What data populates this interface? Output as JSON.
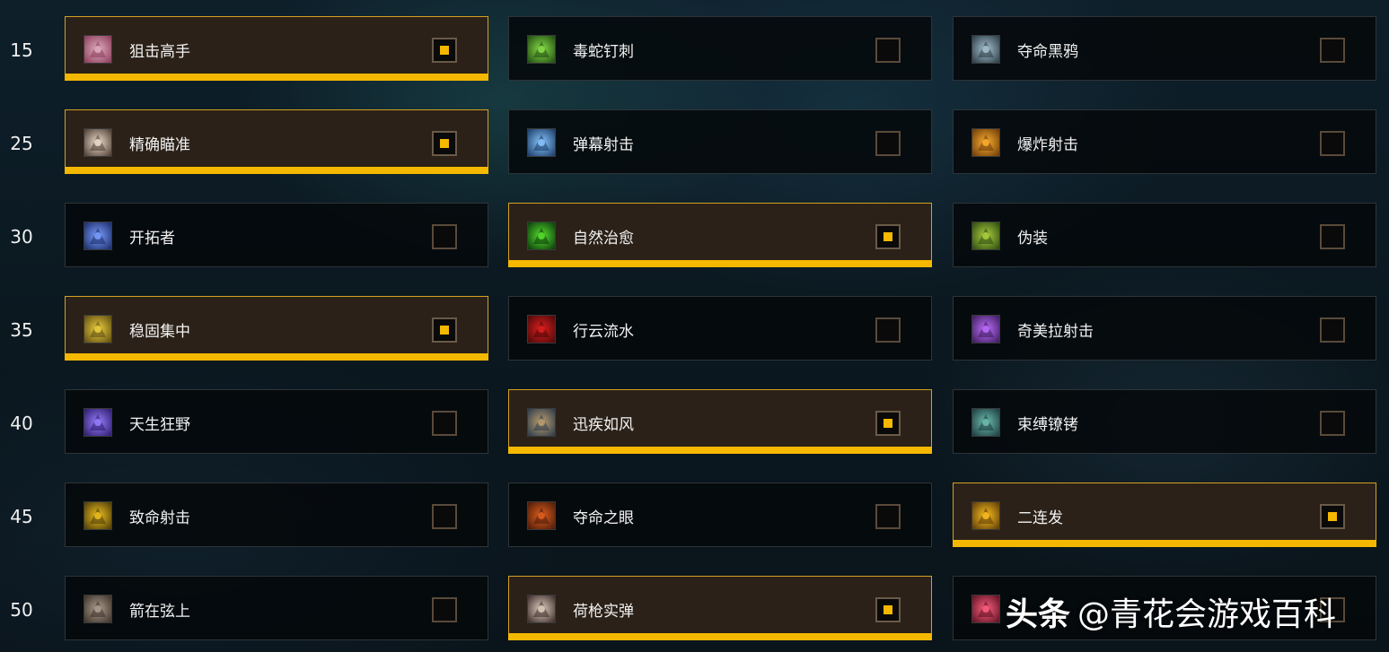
{
  "accent_color": "#f5b800",
  "rows": [
    {
      "level": "15",
      "talents": [
        {
          "name": "狙击高手",
          "selected": true,
          "icon": "eye-icon",
          "c1": "#8a3a5a",
          "c2": "#e0b0c0"
        },
        {
          "name": "毒蛇钉刺",
          "selected": false,
          "icon": "serpent-sting-icon",
          "c1": "#1e4a10",
          "c2": "#8be04a"
        },
        {
          "name": "夺命黑鸦",
          "selected": false,
          "icon": "raven-icon",
          "c1": "#2a3a44",
          "c2": "#a8c4d0"
        }
      ]
    },
    {
      "level": "25",
      "talents": [
        {
          "name": "精确瞄准",
          "selected": true,
          "icon": "aim-icon",
          "c1": "#4a3a30",
          "c2": "#f0e0d0"
        },
        {
          "name": "弹幕射击",
          "selected": false,
          "icon": "barrage-icon",
          "c1": "#1a3a66",
          "c2": "#8ac8ff"
        },
        {
          "name": "爆炸射击",
          "selected": false,
          "icon": "explosive-shot-icon",
          "c1": "#6a3a08",
          "c2": "#ffb030"
        }
      ]
    },
    {
      "level": "30",
      "talents": [
        {
          "name": "开拓者",
          "selected": false,
          "icon": "trailblazer-icon",
          "c1": "#1a2a66",
          "c2": "#7aa0ff"
        },
        {
          "name": "自然治愈",
          "selected": true,
          "icon": "natural-mending-icon",
          "c1": "#0a3a0a",
          "c2": "#58e030"
        },
        {
          "name": "伪装",
          "selected": false,
          "icon": "camouflage-icon",
          "c1": "#2a4a10",
          "c2": "#b0d040"
        }
      ]
    },
    {
      "level": "35",
      "talents": [
        {
          "name": "稳固集中",
          "selected": true,
          "icon": "steady-focus-icon",
          "c1": "#5a4a10",
          "c2": "#f0d040"
        },
        {
          "name": "行云流水",
          "selected": false,
          "icon": "streamline-icon",
          "c1": "#4a0808",
          "c2": "#e02020"
        },
        {
          "name": "奇美拉射击",
          "selected": false,
          "icon": "chimaera-shot-icon",
          "c1": "#3a1a5a",
          "c2": "#c070ff"
        }
      ]
    },
    {
      "level": "40",
      "talents": [
        {
          "name": "天生狂野",
          "selected": false,
          "icon": "born-to-be-wild-icon",
          "c1": "#2a1a6a",
          "c2": "#9a80ff"
        },
        {
          "name": "迅疾如风",
          "selected": true,
          "icon": "posthaste-icon",
          "c1": "#2a3a4a",
          "c2": "#c0a070"
        },
        {
          "name": "束缚镣铐",
          "selected": false,
          "icon": "binding-shackles-icon",
          "c1": "#1a3a40",
          "c2": "#70c0b0"
        }
      ]
    },
    {
      "level": "45",
      "talents": [
        {
          "name": "致命射击",
          "selected": false,
          "icon": "lethal-shots-icon",
          "c1": "#4a3a08",
          "c2": "#f0c020"
        },
        {
          "name": "夺命之眼",
          "selected": false,
          "icon": "dead-eye-icon",
          "c1": "#4a1a08",
          "c2": "#e06020"
        },
        {
          "name": "二连发",
          "selected": true,
          "icon": "double-tap-icon",
          "c1": "#5a3a08",
          "c2": "#ffc020"
        }
      ]
    },
    {
      "level": "50",
      "talents": [
        {
          "name": "箭在弦上",
          "selected": false,
          "icon": "calling-the-shots-icon",
          "c1": "#3a3028",
          "c2": "#b0a090"
        },
        {
          "name": "荷枪实弹",
          "selected": true,
          "icon": "lock-and-load-icon",
          "c1": "#3a2a28",
          "c2": "#e0d0c0"
        },
        {
          "name": "",
          "selected": false,
          "icon": "piercing-shot-icon",
          "c1": "#5a1020",
          "c2": "#ff6080"
        }
      ]
    }
  ],
  "watermark": {
    "brand": "头条",
    "handle": "@青花会游戏百科"
  }
}
